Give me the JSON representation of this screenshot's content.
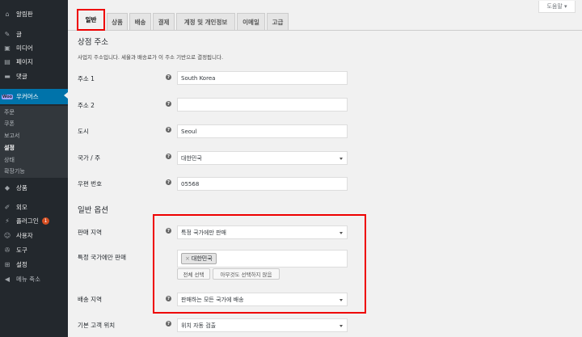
{
  "sidebar": {
    "items": [
      {
        "label": "알림판",
        "icon": "dashboard-icon",
        "glyph": "⌂"
      },
      {
        "label": "글",
        "icon": "pin-icon",
        "glyph": "✎"
      },
      {
        "label": "미디어",
        "icon": "media-icon",
        "glyph": "▣"
      },
      {
        "label": "페이지",
        "icon": "page-icon",
        "glyph": "▤"
      },
      {
        "label": "댓글",
        "icon": "comment-icon",
        "glyph": "▬"
      },
      {
        "label": "우커머스",
        "icon": "woocommerce-icon",
        "glyph": "Woo"
      },
      {
        "label": "상품",
        "icon": "product-icon",
        "glyph": "◆"
      },
      {
        "label": "외모",
        "icon": "appearance-icon",
        "glyph": "✐"
      },
      {
        "label": "플러그인",
        "icon": "plugin-icon",
        "glyph": "⚡",
        "badge": "1"
      },
      {
        "label": "사용자",
        "icon": "user-icon",
        "glyph": "☺"
      },
      {
        "label": "도구",
        "icon": "tools-icon",
        "glyph": "✇"
      },
      {
        "label": "설정",
        "icon": "settings-icon",
        "glyph": "⊞"
      },
      {
        "label": "메뉴 축소",
        "icon": "collapse-icon",
        "glyph": "◀"
      }
    ],
    "submenu": [
      "주문",
      "쿠폰",
      "보고서",
      "설정",
      "상태",
      "확장기능"
    ]
  },
  "help_tab": "도움말 ▾",
  "tabs": [
    "일반",
    "상품",
    "배송",
    "결제",
    "계정 및 개인정보",
    "이메일",
    "고급"
  ],
  "store_address": {
    "title": "상점 주소",
    "description": "사업지 주소입니다. 세율과 배송료가 이 주소 기반으로 결정됩니다.",
    "fields": [
      {
        "label": "주소 1",
        "value": "South Korea"
      },
      {
        "label": "주소 2",
        "value": ""
      },
      {
        "label": "도시",
        "value": "Seoul"
      },
      {
        "label": "국가 / 주",
        "value": "대한민국"
      },
      {
        "label": "우편 번호",
        "value": "05568"
      }
    ]
  },
  "general_options": {
    "title": "일반 옵션",
    "sell_locations": {
      "label": "판매 지역",
      "value": "특정 국가에만 판매"
    },
    "specific_countries": {
      "label": "특정 국가에만 판매",
      "tags": [
        "대한민국"
      ],
      "select_all": "전체 선택",
      "select_none": "아무것도 선택하지 않음"
    },
    "ship_locations": {
      "label": "배송 지역",
      "value": "판매하는 모든 국가에 배송"
    },
    "default_customer_location": {
      "label": "기본 고객 위치",
      "value": "위치 자동 검출"
    }
  },
  "colors": {
    "accent": "#0073aa",
    "sidebar": "#23282d",
    "highlight": "#ee0000"
  }
}
